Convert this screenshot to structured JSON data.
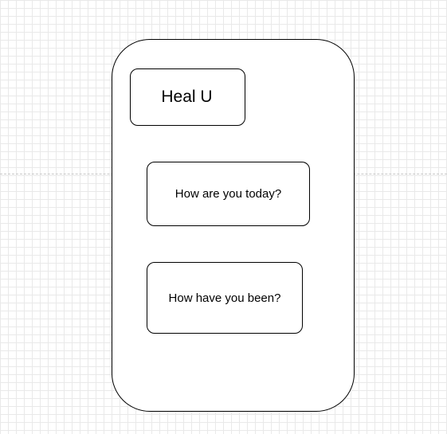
{
  "app": {
    "title": "Heal U"
  },
  "prompts": [
    {
      "label": "How are you today?"
    },
    {
      "label": "How have you been?"
    }
  ]
}
